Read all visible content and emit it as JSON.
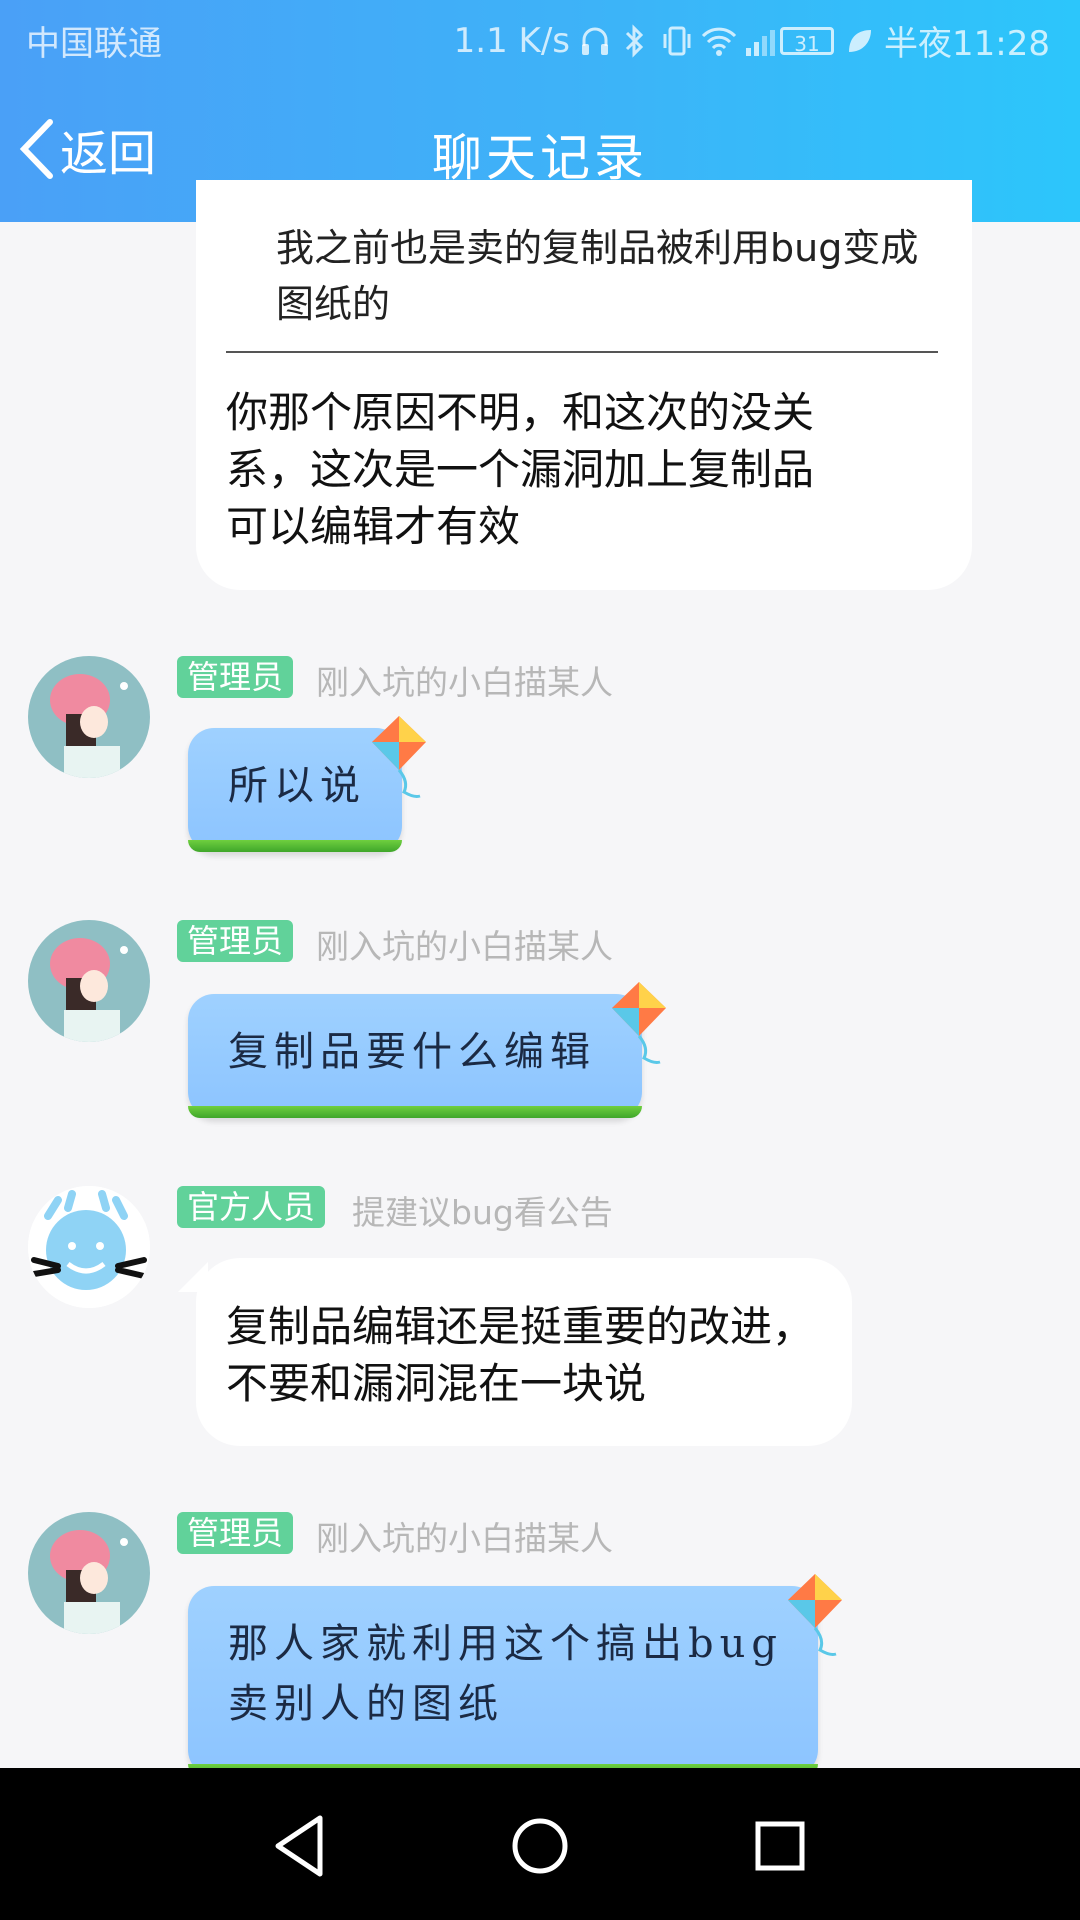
{
  "status_bar": {
    "carrier": "中国联通",
    "speed": "1.1 K/s",
    "battery": "31",
    "time": "半夜11:28"
  },
  "header": {
    "back_label": "返回",
    "title": "聊天记录"
  },
  "messages": [
    {
      "quote_text": "我之前也是卖的复制品被利用bug变成图纸的",
      "text": "你那个原因不明，和这次的没关系，这次是一个漏洞加上复制品可以编辑才有效"
    },
    {
      "tag": "管理员",
      "sender": "刚入坑的小白描某人",
      "text": "所以说"
    },
    {
      "tag": "管理员",
      "sender": "刚入坑的小白描某人",
      "text": "复制品要什么编辑"
    },
    {
      "tag": "官方人员",
      "sender": "提建议bug看公告",
      "text": "复制品编辑还是挺重要的改进，不要和漏洞混在一块说"
    },
    {
      "tag": "管理员",
      "sender": "刚入坑的小白描某人",
      "text_line1": "那人家就利用这个搞出bug",
      "text_line2": "卖别人的图纸"
    }
  ],
  "icons": {
    "back": "chevron-left-icon",
    "nav_back": "triangle-back-icon",
    "nav_home": "circle-home-icon",
    "nav_recent": "square-recent-icon"
  },
  "colors": {
    "header_start": "#4aa0f7",
    "header_end": "#2cc6fb",
    "tag_green": "#61d29a",
    "bubble_blue": "#9fd1ff"
  }
}
